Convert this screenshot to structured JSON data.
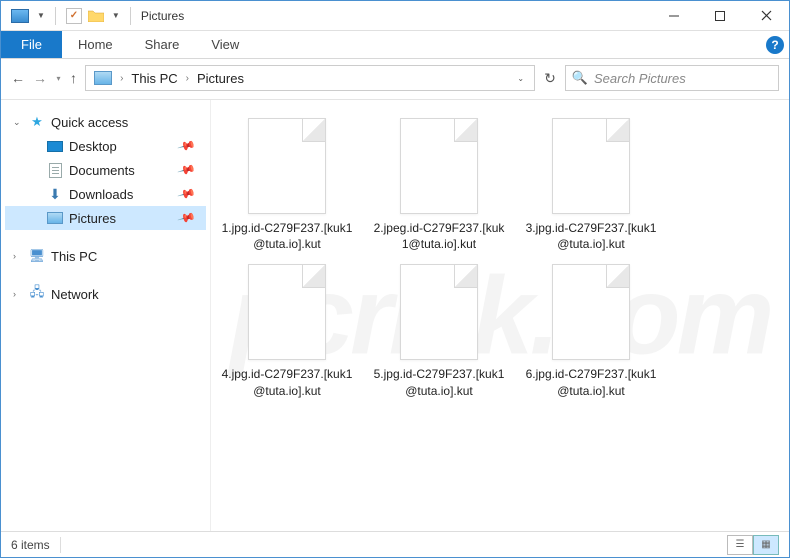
{
  "titlebar": {
    "label": "Pictures"
  },
  "ribbon": {
    "file": "File",
    "tabs": [
      "Home",
      "Share",
      "View"
    ]
  },
  "address": {
    "crumbs": [
      "This PC",
      "Pictures"
    ]
  },
  "search": {
    "placeholder": "Search Pictures"
  },
  "sidebar": {
    "quick_access": "Quick access",
    "items": [
      {
        "label": "Desktop"
      },
      {
        "label": "Documents"
      },
      {
        "label": "Downloads"
      },
      {
        "label": "Pictures"
      }
    ],
    "this_pc": "This PC",
    "network": "Network"
  },
  "files": [
    {
      "name": "1.jpg.id-C279F237.[kuk1@tuta.io].kut"
    },
    {
      "name": "2.jpeg.id-C279F237.[kuk1@tuta.io].kut"
    },
    {
      "name": "3.jpg.id-C279F237.[kuk1@tuta.io].kut"
    },
    {
      "name": "4.jpg.id-C279F237.[kuk1@tuta.io].kut"
    },
    {
      "name": "5.jpg.id-C279F237.[kuk1@tuta.io].kut"
    },
    {
      "name": "6.jpg.id-C279F237.[kuk1@tuta.io].kut"
    }
  ],
  "status": {
    "count": "6 items"
  },
  "watermark": "pcrisk.com"
}
